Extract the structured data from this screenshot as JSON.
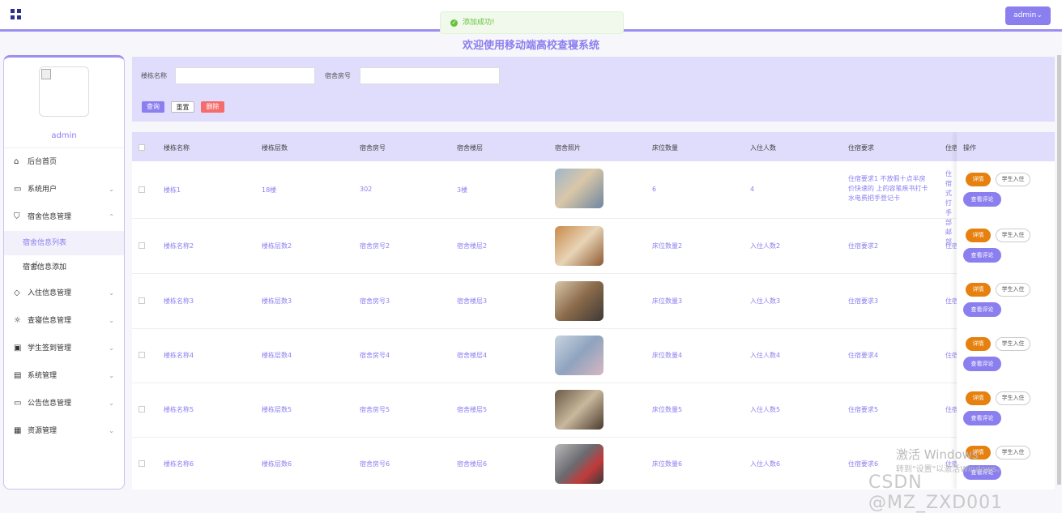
{
  "topbar": {
    "admin_label": "admin⌄",
    "toast": "添加成功!"
  },
  "page_title": "欢迎使用移动端高校查寝系统",
  "sidebar": {
    "username": "admin",
    "menu": [
      {
        "label": "后台首页",
        "icon": "home-icon"
      },
      {
        "label": "系统用户",
        "icon": "monitor-icon"
      },
      {
        "label": "宿舍信息管理",
        "icon": "bookmark-icon"
      },
      {
        "label": "宿舍信息列表",
        "icon": ""
      },
      {
        "label": "宿舍信息添加",
        "icon": ""
      },
      {
        "label": "入住信息管理",
        "icon": "tag-icon"
      },
      {
        "label": "查寝信息管理",
        "icon": "sun-icon"
      },
      {
        "label": "学生签到管理",
        "icon": "inbox-icon"
      },
      {
        "label": "系统管理",
        "icon": "clipboard-icon"
      },
      {
        "label": "公告信息管理",
        "icon": "message-icon"
      },
      {
        "label": "资源管理",
        "icon": "box-icon"
      }
    ]
  },
  "search": {
    "building_label": "楼栋名称",
    "room_label": "宿舍房号",
    "query": "查询",
    "reset": "重置",
    "delete": "删除"
  },
  "table": {
    "headers": [
      "楼栋名称",
      "楼栋层数",
      "宿舍房号",
      "宿舍楼层",
      "宿舍照片",
      "床位数量",
      "入住人数",
      "住宿要求",
      "住宿",
      "操作"
    ],
    "rows": [
      {
        "building": "楼栋1",
        "floors": "18楼",
        "room": "302",
        "room_floor": "3楼",
        "beds": "6",
        "occupants": "4",
        "requirement": "住宿要求1 不放假十点半房价快速的 上的容笔疾书打卡水电费把手登记卡",
        "extra": "住宿式打手部邮部"
      },
      {
        "building": "楼栋名称2",
        "floors": "楼栋层数2",
        "room": "宿舍房号2",
        "room_floor": "宿舍楼层2",
        "beds": "床位数量2",
        "occupants": "入住人数2",
        "requirement": "住宿要求2",
        "extra": "住宿"
      },
      {
        "building": "楼栋名称3",
        "floors": "楼栋层数3",
        "room": "宿舍房号3",
        "room_floor": "宿舍楼层3",
        "beds": "床位数量3",
        "occupants": "入住人数3",
        "requirement": "住宿要求3",
        "extra": "住宿"
      },
      {
        "building": "楼栋名称4",
        "floors": "楼栋层数4",
        "room": "宿舍房号4",
        "room_floor": "宿舍楼层4",
        "beds": "床位数量4",
        "occupants": "入住人数4",
        "requirement": "住宿要求4",
        "extra": "住宿"
      },
      {
        "building": "楼栋名称5",
        "floors": "楼栋层数5",
        "room": "宿舍房号5",
        "room_floor": "宿舍楼层5",
        "beds": "床位数量5",
        "occupants": "入住人数5",
        "requirement": "住宿要求5",
        "extra": "住宿"
      },
      {
        "building": "楼栋名称6",
        "floors": "楼栋层数6",
        "room": "宿舍房号6",
        "room_floor": "宿舍楼层6",
        "beds": "床位数量6",
        "occupants": "入住人数6",
        "requirement": "住宿要求6",
        "extra": "住宿"
      }
    ],
    "actions": {
      "detail": "详情",
      "checkin": "学生入住",
      "review": "查看评论"
    }
  },
  "watermarks": {
    "activate": "激活 Windows",
    "activate_sub": "转到\"设置\"以激活Windows。",
    "csdn": "CSDN @MZ_ZXD001"
  },
  "colors": {
    "accent": "#8b7ff0",
    "panel": "#e0dcfb",
    "detail": "#e6800e",
    "danger": "#f56c6c",
    "success": "#67c23a"
  }
}
